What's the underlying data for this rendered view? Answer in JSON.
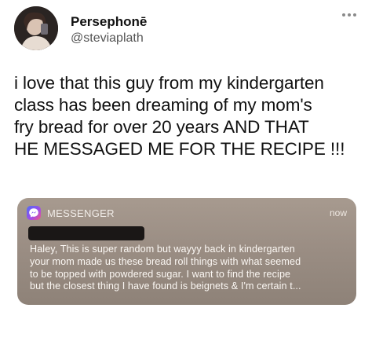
{
  "tweet": {
    "display_name": "Persephonē",
    "handle": "@steviaplath",
    "avatar_icon": "profile-photo",
    "more_icon": "ellipsis-icon",
    "text_lines": [
      "i love that this guy from my kindergarten",
      "class has been dreaming of my mom's",
      "fry bread for over 20 years AND THAT",
      "HE MESSAGED ME FOR THE RECIPE !!!"
    ]
  },
  "notification": {
    "app_name": "MESSENGER",
    "app_icon": "messenger-icon",
    "time": "now",
    "sender_redacted": true,
    "message_lines": [
      "Haley, This is super random but wayyy back in kindergarten",
      "your mom made us these bread roll things with what seemed",
      "to be topped with powdered sugar. I want to find the recipe",
      "but the closest thing I have found is beignets & I'm certain t..."
    ]
  },
  "colors": {
    "background": "#ffffff",
    "text": "#111111",
    "handle": "#555555",
    "notification_bg": "#9c8f85"
  }
}
